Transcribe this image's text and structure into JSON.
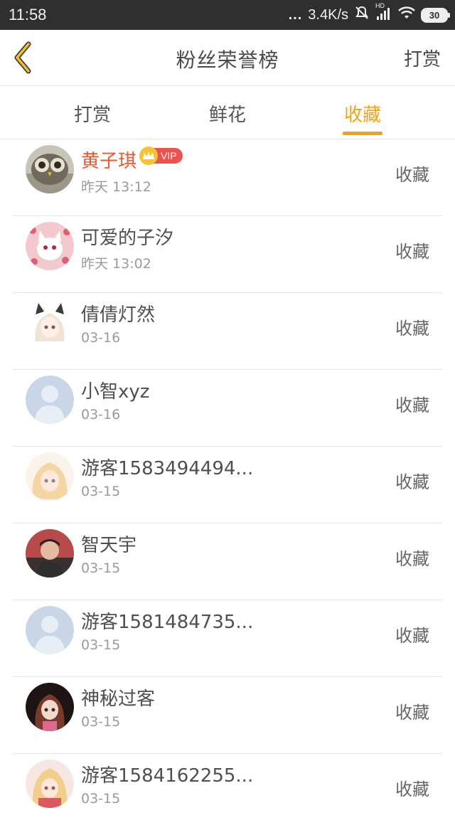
{
  "status_bar": {
    "time": "11:58",
    "dots": "...",
    "network_speed": "3.4K/s",
    "hd_label": "HD",
    "battery": "30",
    "icons": [
      "mute-icon",
      "signal-icon",
      "wifi-icon",
      "battery-icon"
    ]
  },
  "header": {
    "title": "粉丝荣誉榜",
    "action": "打赏",
    "back_icon": "chevron-left-icon"
  },
  "tabs": [
    {
      "label": "打赏",
      "active": false
    },
    {
      "label": "鲜花",
      "active": false
    },
    {
      "label": "收藏",
      "active": true
    }
  ],
  "colors": {
    "accent": "#f0a21a",
    "vip_name": "#e8582c",
    "vip_tag": "#e9544f",
    "status_bar_bg": "#2f2f2f"
  },
  "list": [
    {
      "name": "黄子琪",
      "date": "昨天 13:12",
      "action": "收藏",
      "vip": true,
      "vip_label": "VIP",
      "avatar": "owl-avatar"
    },
    {
      "name": "可爱的子汐",
      "date": "昨天 13:02",
      "action": "收藏",
      "avatar": "cat-anime-avatar"
    },
    {
      "name": "倩倩灯然",
      "date": "03-16",
      "action": "收藏",
      "avatar": "anime-girl-avatar"
    },
    {
      "name": "小智xyz",
      "date": "03-16",
      "action": "收藏",
      "avatar": "default-avatar"
    },
    {
      "name": "游客1583494494...",
      "date": "03-15",
      "action": "收藏",
      "avatar": "anime-blonde-avatar"
    },
    {
      "name": "智天宇",
      "date": "03-15",
      "action": "收藏",
      "avatar": "photo-avatar"
    },
    {
      "name": "游客1581484735...",
      "date": "03-15",
      "action": "收藏",
      "avatar": "default-avatar"
    },
    {
      "name": "神秘过客",
      "date": "03-15",
      "action": "收藏",
      "avatar": "doll-avatar"
    },
    {
      "name": "游客1584162255...",
      "date": "03-15",
      "action": "收藏",
      "avatar": "anime-pink-avatar"
    }
  ]
}
